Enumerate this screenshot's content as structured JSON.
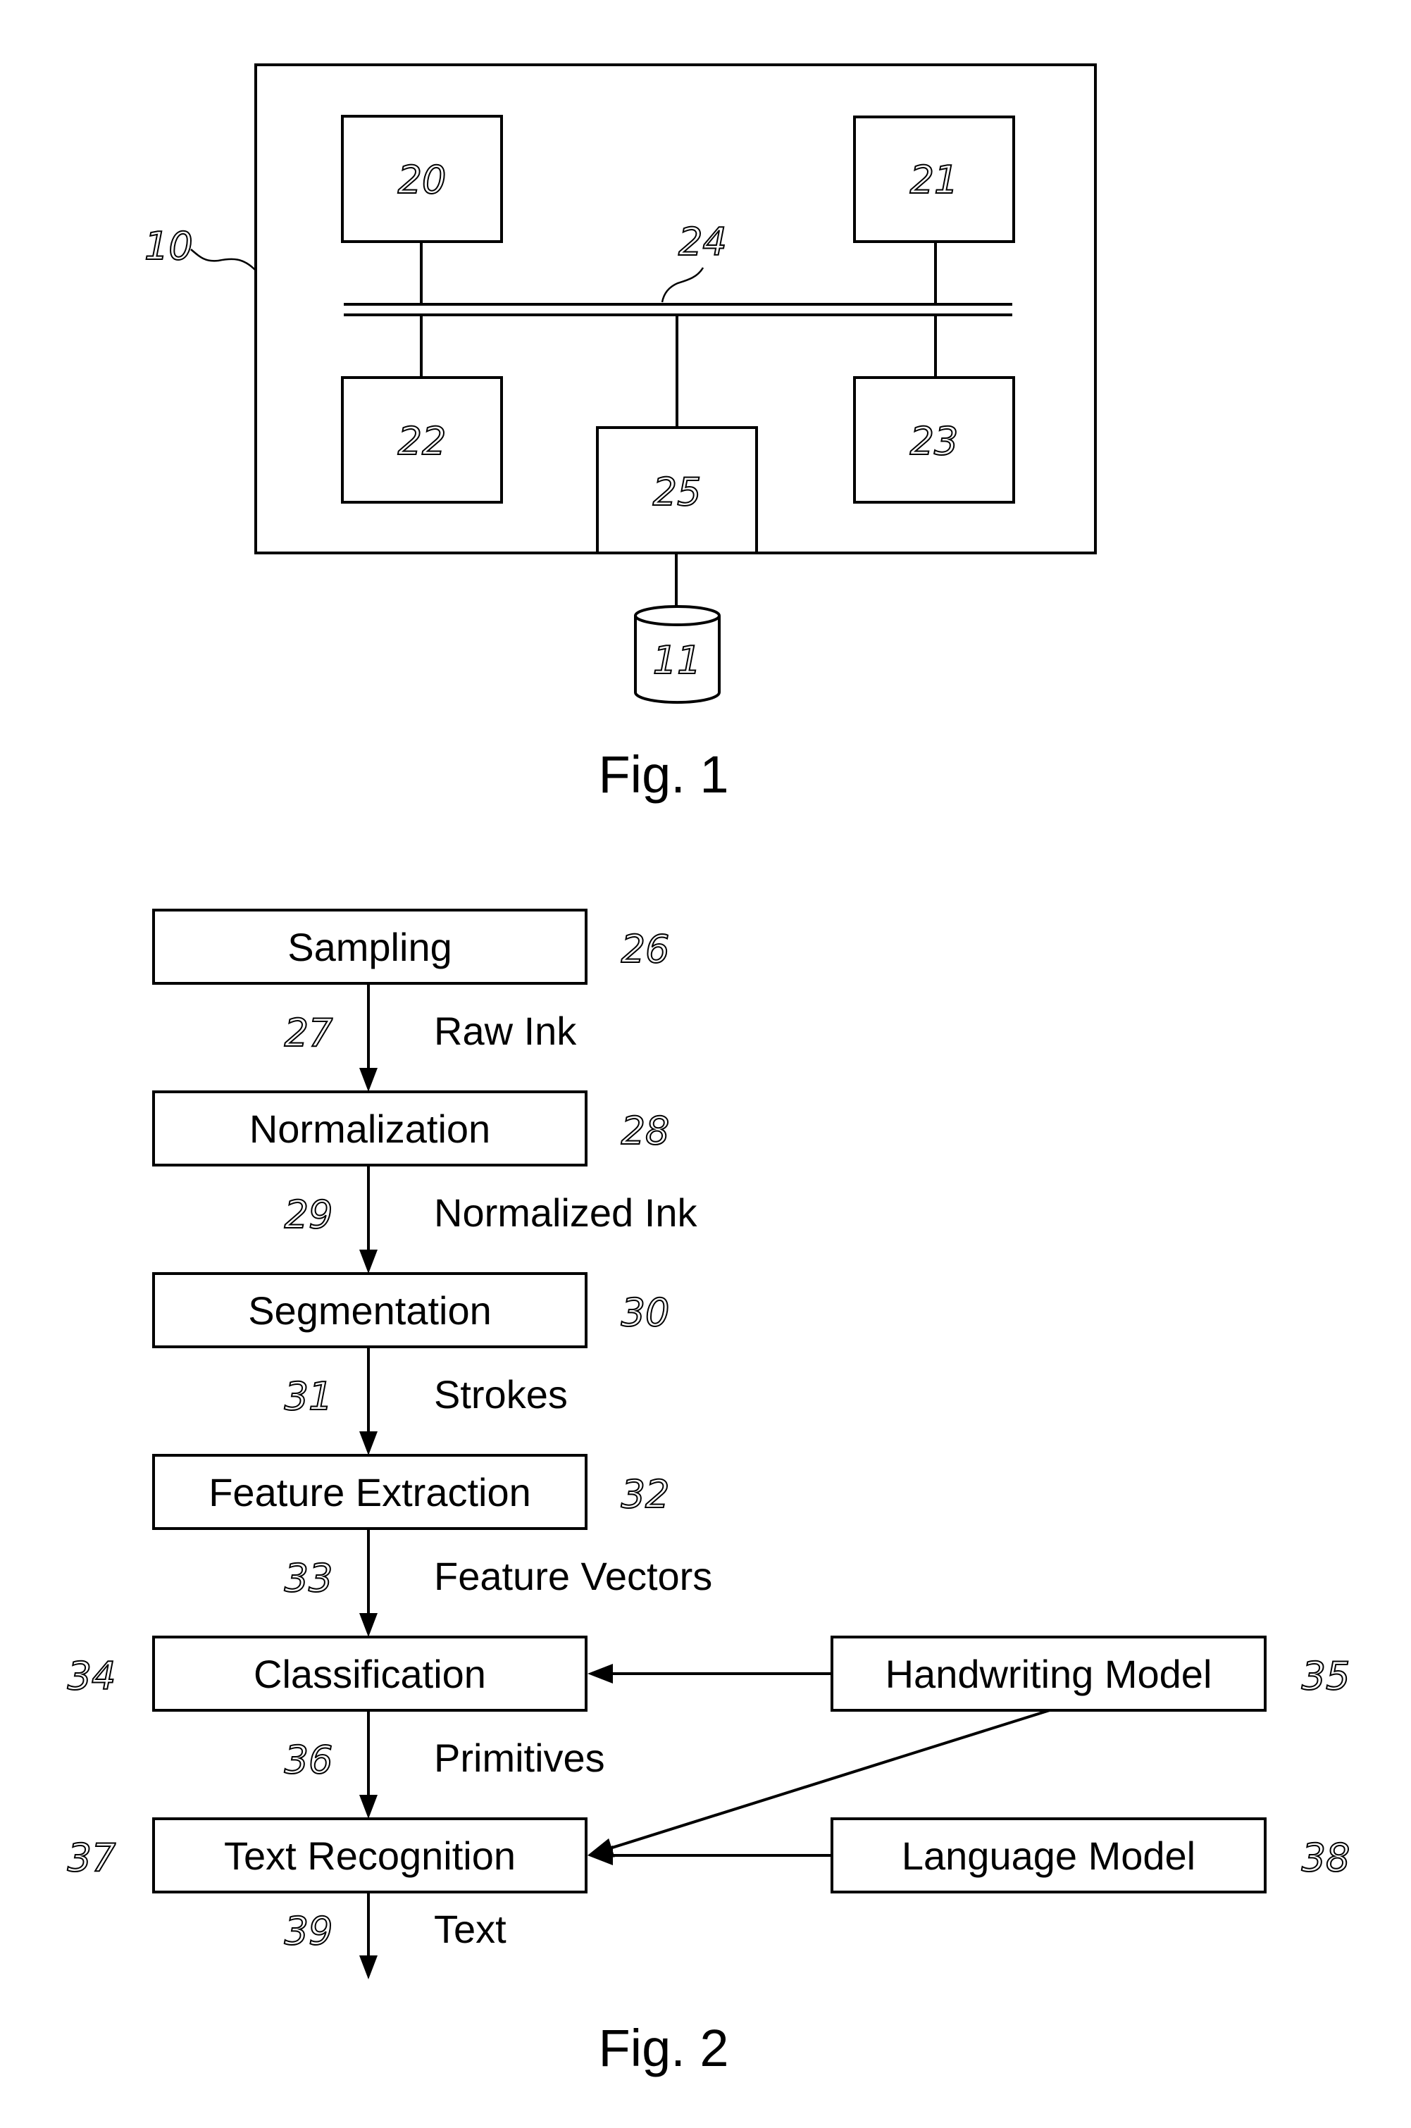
{
  "fig1": {
    "caption": "Fig. 1",
    "system_ref": "10",
    "storage_ref": "11",
    "bus_ref": "24",
    "components": [
      {
        "ref": "20"
      },
      {
        "ref": "21"
      },
      {
        "ref": "22"
      },
      {
        "ref": "23"
      },
      {
        "ref": "25"
      }
    ]
  },
  "fig2": {
    "caption": "Fig. 2",
    "steps": [
      {
        "label": "Sampling",
        "ref": "26"
      },
      {
        "label": "Normalization",
        "ref": "28"
      },
      {
        "label": "Segmentation",
        "ref": "30"
      },
      {
        "label": "Feature Extraction",
        "ref": "32"
      },
      {
        "label": "Classification",
        "ref": "34"
      },
      {
        "label": "Text Recognition",
        "ref": "37"
      }
    ],
    "flows": [
      {
        "label": "Raw Ink",
        "ref": "27"
      },
      {
        "label": "Normalized Ink",
        "ref": "29"
      },
      {
        "label": "Strokes",
        "ref": "31"
      },
      {
        "label": "Feature Vectors",
        "ref": "33"
      },
      {
        "label": "Primitives",
        "ref": "36"
      },
      {
        "label": "Text",
        "ref": "39"
      }
    ],
    "models": [
      {
        "label": "Handwriting Model",
        "ref": "35"
      },
      {
        "label": "Language Model",
        "ref": "38"
      }
    ]
  }
}
